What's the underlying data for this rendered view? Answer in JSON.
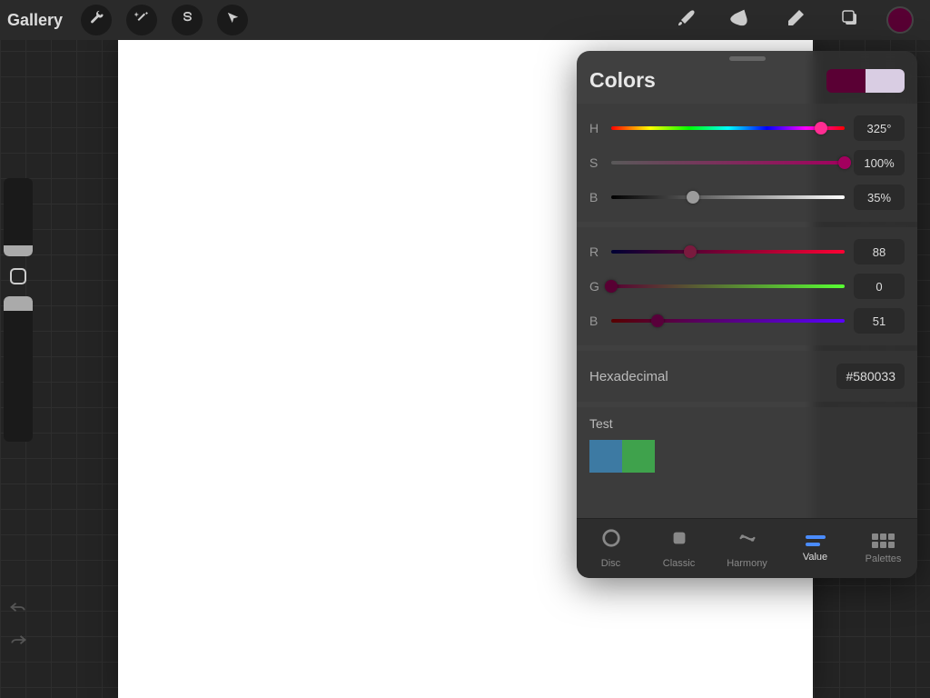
{
  "topbar": {
    "gallery": "Gallery"
  },
  "color_current": "#580033",
  "panel": {
    "title": "Colors",
    "swatch_prev": "#5a0034",
    "swatch_secondary": "#d9cde3",
    "hsb": {
      "h": {
        "label": "H",
        "value": "325°",
        "pos": 90
      },
      "s": {
        "label": "S",
        "value": "100%",
        "pos": 100
      },
      "b": {
        "label": "B",
        "value": "35%",
        "pos": 35
      }
    },
    "rgb": {
      "r": {
        "label": "R",
        "value": "88",
        "pos": 34
      },
      "g": {
        "label": "G",
        "value": "0",
        "pos": 0
      },
      "b": {
        "label": "B",
        "value": "51",
        "pos": 20
      }
    },
    "hex": {
      "label": "Hexadecimal",
      "value": "#580033"
    },
    "palette": {
      "name": "Test",
      "swatches": [
        "#3d7aa3",
        "#3fa24c"
      ]
    },
    "tabs": {
      "disc": "Disc",
      "classic": "Classic",
      "harmony": "Harmony",
      "value": "Value",
      "palettes": "Palettes"
    }
  }
}
